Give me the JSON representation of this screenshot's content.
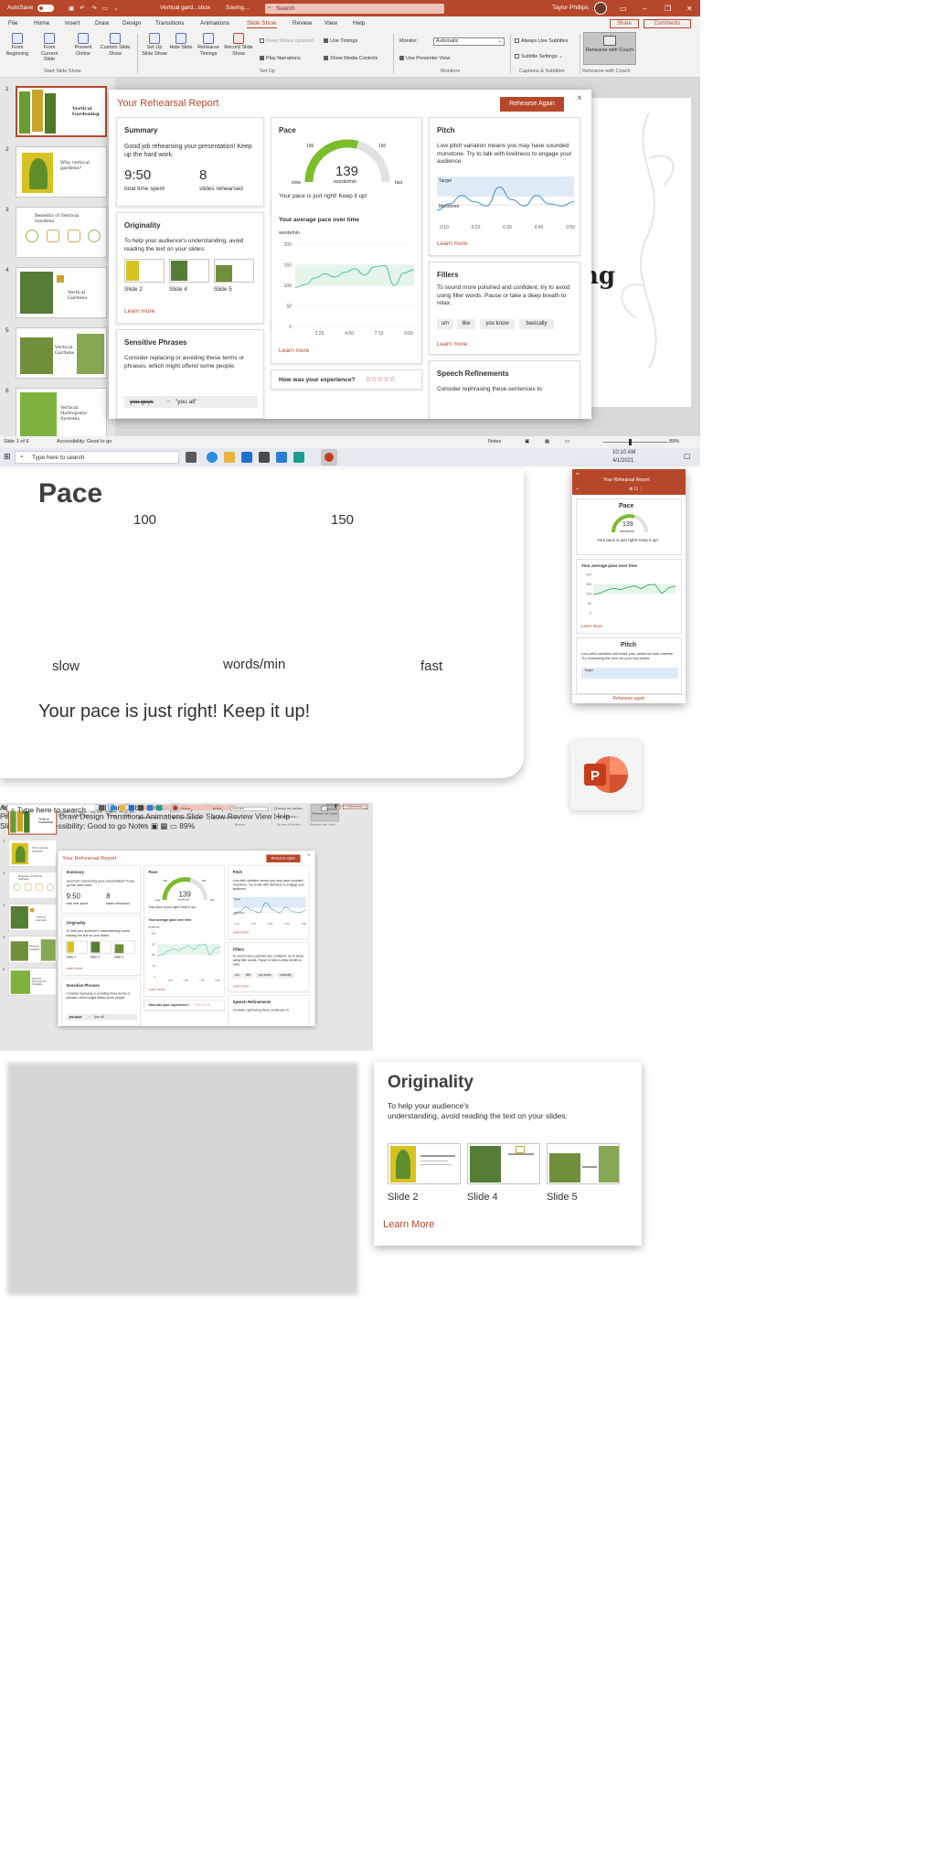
{
  "titlebar": {
    "autosave": "AutoSave",
    "autosave_state": "On",
    "filename": "Vertical gard...sbox",
    "status": "Saving...",
    "search_placeholder": "Search",
    "user": "Taylor Phillips"
  },
  "menu": {
    "items": [
      "File",
      "Home",
      "Insert",
      "Draw",
      "Design",
      "Transitions",
      "Animations",
      "Slide Show",
      "Review",
      "View",
      "Help"
    ],
    "active": "Slide Show",
    "share": "Share",
    "comments": "Comments"
  },
  "ribbon": {
    "start": [
      {
        "label": "From Beginning"
      },
      {
        "label": "From Current Slide"
      },
      {
        "label": "Present Online"
      },
      {
        "label": "Custom Slide Show"
      }
    ],
    "setup": [
      {
        "label": "Set Up Slide Show"
      },
      {
        "label": "Hide Slide"
      },
      {
        "label": "Rehearse Timings"
      },
      {
        "label": "Record Slide Show"
      }
    ],
    "setup_checks": [
      {
        "label": "Keep Slides Updated",
        "checked": false
      },
      {
        "label": "Use Timings",
        "checked": true
      },
      {
        "label": "Play Narrations",
        "checked": true
      },
      {
        "label": "Show Media Controls",
        "checked": true
      }
    ],
    "monitor_label": "Monitor:",
    "monitor_value": "Automatic",
    "presenter_view": "Use Presenter View",
    "captions_checks": [
      "Always Use Subtitles",
      "Subtitle Settings"
    ],
    "coach": "Rehearse with Coach",
    "groups": [
      "Start Slide Show",
      "Set Up",
      "Monitors",
      "Captions & Subtitles",
      "Rehearse with Coach"
    ]
  },
  "thumbnails": [
    {
      "num": "1",
      "title": "Vertical Gardening"
    },
    {
      "num": "2",
      "title": "Why vertical gardens?"
    },
    {
      "num": "3",
      "title": "Benefits of Vertical Gardens"
    },
    {
      "num": "4",
      "title": "Vertical Gardens"
    },
    {
      "num": "5",
      "title": "Vertical Gardens"
    },
    {
      "num": "6",
      "title": "Vertical Hydroponic Systems"
    }
  ],
  "slide": {
    "visible_word": "ng"
  },
  "statusbar": {
    "slide_info": "Slide 1 of 6",
    "accessibility": "Accessibility: Good to go",
    "notes": "Notes",
    "zoom": "89%"
  },
  "taskbar": {
    "search": "Type here to search",
    "time": "10:10 AM",
    "date": "4/1/2021"
  },
  "report": {
    "title": "Your Rehearsal Report",
    "rehearse_again": "Rehearse Again",
    "close": "×",
    "summary": {
      "heading": "Summary",
      "text": "Good job rehearsing your presentation! Keep up the hard work.",
      "time": "9:50",
      "time_label": "total time spent",
      "slides": "8",
      "slides_label": "slides rehearsed"
    },
    "originality": {
      "heading": "Originality",
      "text": "To help your audience's understanding, avoid reading the text on your slides:",
      "slides": [
        "Slide 2",
        "Slide 4",
        "Slide 5"
      ],
      "learn_more": "Learn more"
    },
    "sensitive": {
      "heading": "Sensitive Phrases",
      "text": "Consider replacing or avoiding these terms or phrases, which might offend some people.",
      "from": "you guys",
      "to": "\"you all\""
    },
    "pace": {
      "heading": "Pace",
      "value": "139",
      "unit": "words/min",
      "low_mark": "100",
      "high_mark": "150",
      "slow": "slow",
      "fast": "fast",
      "message": "Your pace is just right! Keep it up!",
      "over_time_heading": "Your average pace over time",
      "y_unit": "words/min",
      "learn_more": "Learn more"
    },
    "experience": {
      "question": "How was your experience?",
      "stars": 5
    },
    "pitch": {
      "heading": "Pitch",
      "text": "Low pitch variation means you may have sounded monotone. Try to talk with liveliness to engage your audience.",
      "target": "Target",
      "monotone": "Monotone",
      "learn_more": "Learn more"
    },
    "fillers": {
      "heading": "Fillers",
      "text": "To sound more polished and confident, try to avoid using filler words. Pause or take a deep breath to relax.",
      "words": [
        "um",
        "like",
        "you know",
        "basically"
      ],
      "learn_more": "Learn more"
    },
    "refinements": {
      "heading": "Speech Refinements",
      "text": "Consider rephrasing these sentences to"
    }
  },
  "chart_data": [
    {
      "type": "line",
      "title": "Your average pace over time",
      "ylabel": "words/min",
      "x": [
        "2:25",
        "4:50",
        "7:15",
        "9:50"
      ],
      "ylim": [
        0,
        200
      ],
      "y_ticks": [
        0,
        50,
        100,
        150,
        200
      ],
      "series": [
        {
          "values": [
            95,
            102,
            118,
            128,
            120,
            132,
            140,
            125,
            145,
            148,
            100,
            130,
            138
          ]
        }
      ],
      "target_band": [
        100,
        150
      ]
    },
    {
      "type": "line",
      "title": "Pitch",
      "x": [
        "0:10",
        "0:20",
        "0:30",
        "0:40",
        "0:50"
      ],
      "series": [
        {
          "values": [
            0.2,
            0.35,
            0.55,
            0.4,
            0.3,
            0.75,
            0.45,
            0.3,
            0.55,
            0.35,
            0.3,
            0.4
          ]
        }
      ]
    }
  ],
  "bigpace": {
    "heading": "Pace",
    "low_mark": "100",
    "high_mark": "150",
    "slow": "slow",
    "unit": "words/min",
    "fast": "fast",
    "message": "Your pace is just right! Keep it up!"
  },
  "phone": {
    "title": "Your Rehearsal Report",
    "pace_heading": "Pace",
    "value": "139",
    "unit": "words/min",
    "message": "Your pace is just right! Keep it up!",
    "over_time": "Your average pace over time",
    "learn_more": "Learn More",
    "pitch_heading": "Pitch",
    "pitch_text": "Low pitch variation will make your audience lose interest. Try increasing the tone for your key points.",
    "target": "Target",
    "rehearse_again": "Rehearse again"
  },
  "bigorig": {
    "heading": "Originality",
    "text1": "To help your audience's",
    "text2": "understanding, avoid reading the text on your slides:",
    "slides": [
      "Slide 2",
      "Slide 4",
      "Slide 5"
    ],
    "learn_more": "Learn More"
  },
  "colors": {
    "accent": "#b7472a",
    "green": "#7bbd2a",
    "chart_line": "#4bc59a",
    "pitch_line": "#3a8fd4"
  }
}
